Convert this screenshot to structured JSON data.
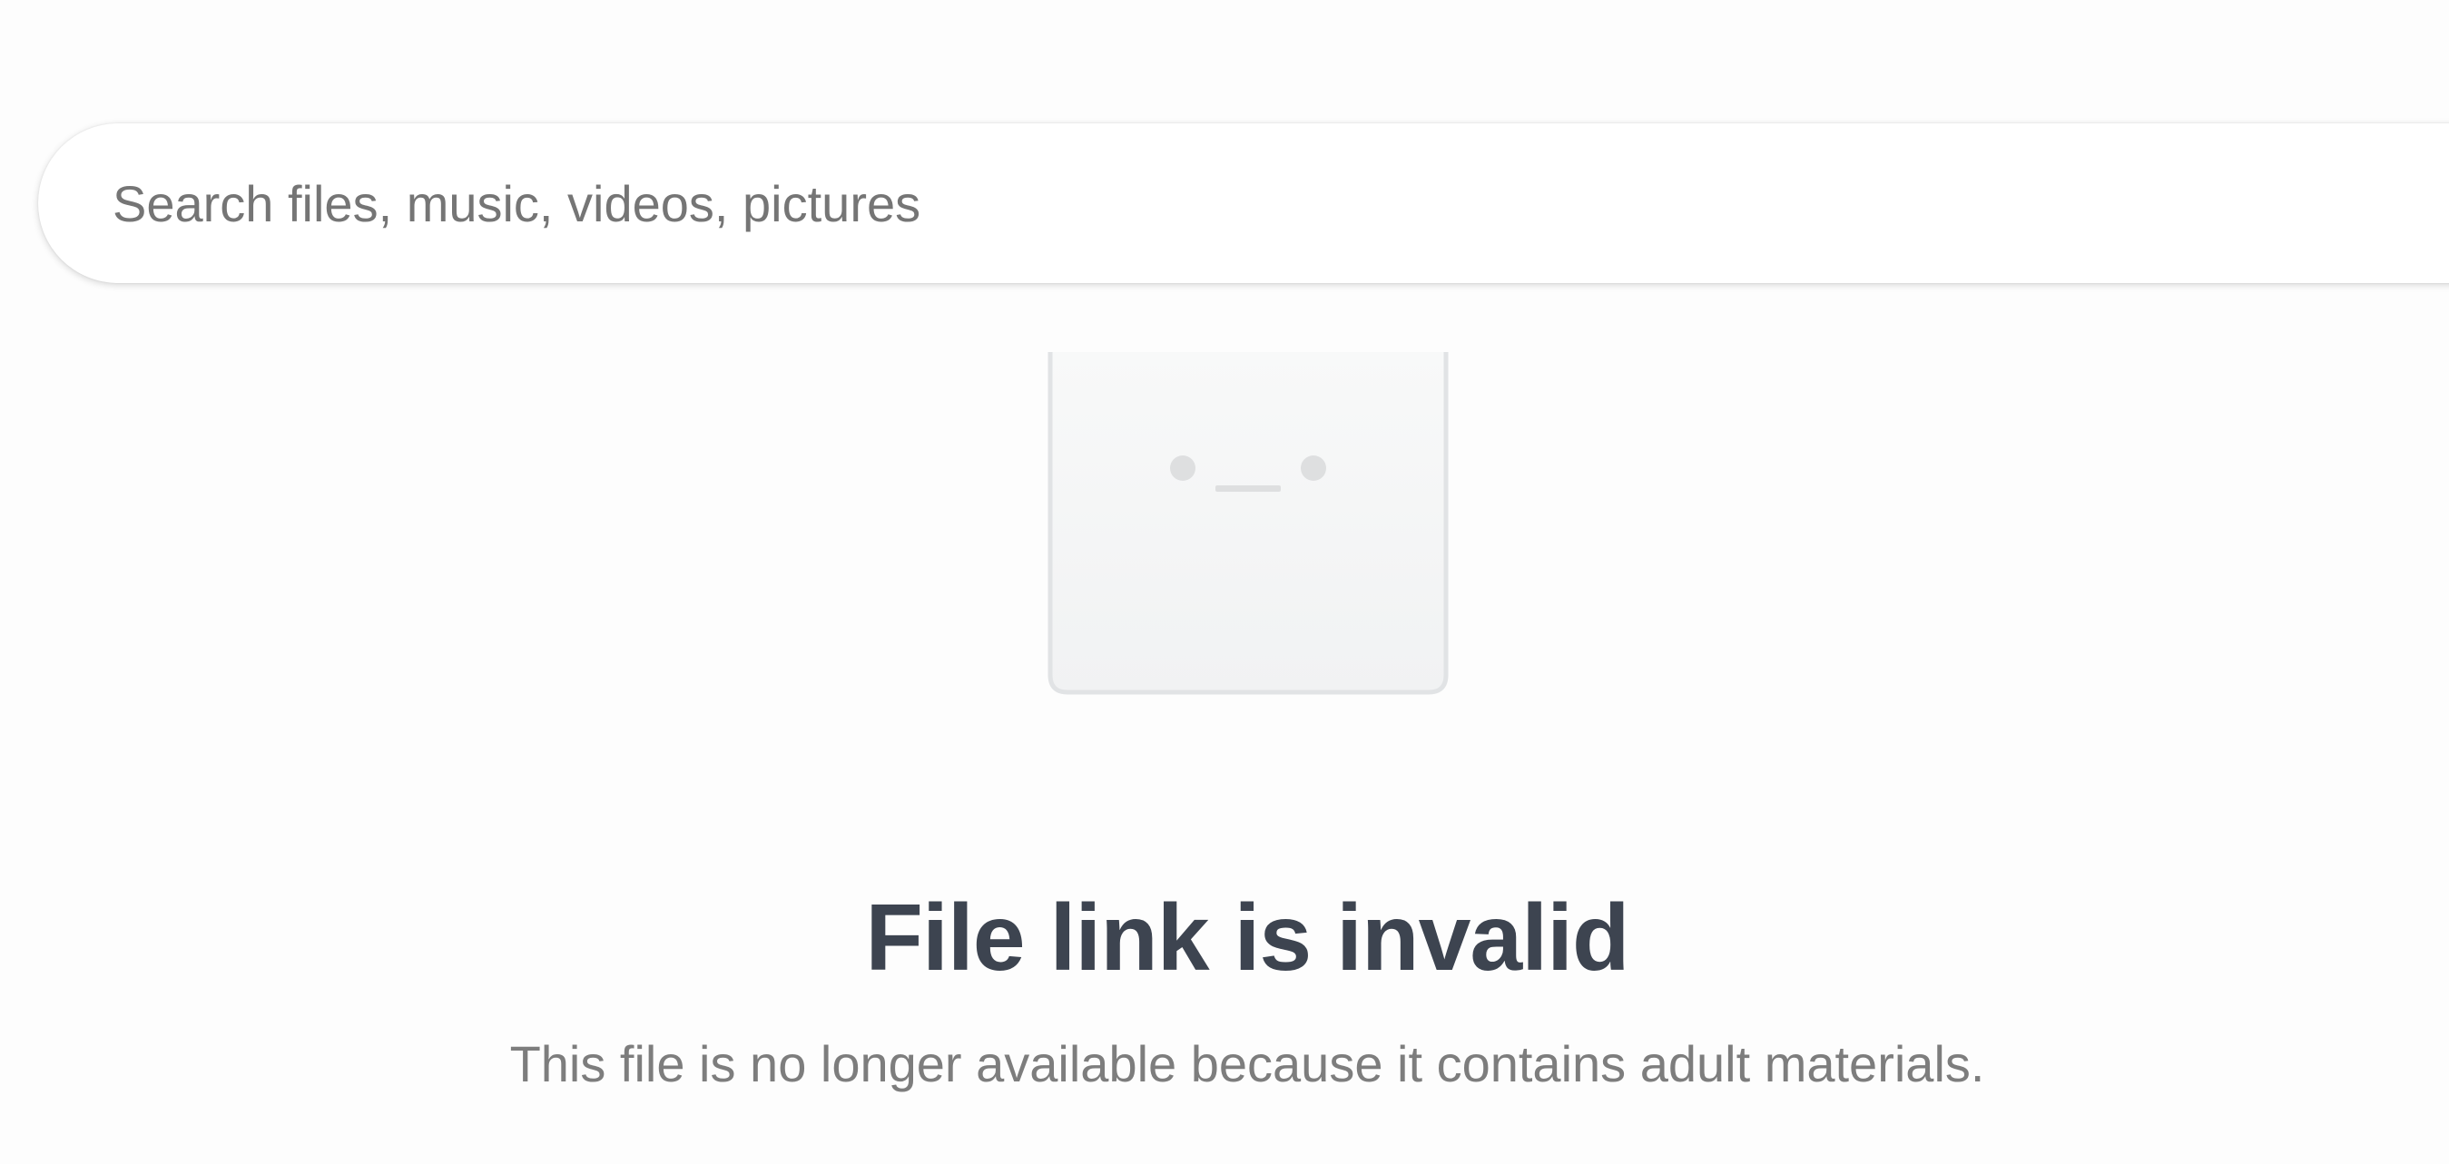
{
  "search": {
    "placeholder": "Search files, music, videos, pictures",
    "value": ""
  },
  "illustration": {
    "icon": "sad-file-icon",
    "colors": {
      "fill_top": "#f8f9f9",
      "fill_bottom": "#f1f2f3",
      "stroke": "#e1e3e5",
      "face": "#dedfe0"
    }
  },
  "error": {
    "title": "File link is invalid",
    "message": "This file is no longer available because it contains adult materials."
  },
  "colors": {
    "background": "#fdfdfd",
    "title": "#3d4450",
    "message": "#7d7d7d",
    "placeholder": "#757575"
  }
}
